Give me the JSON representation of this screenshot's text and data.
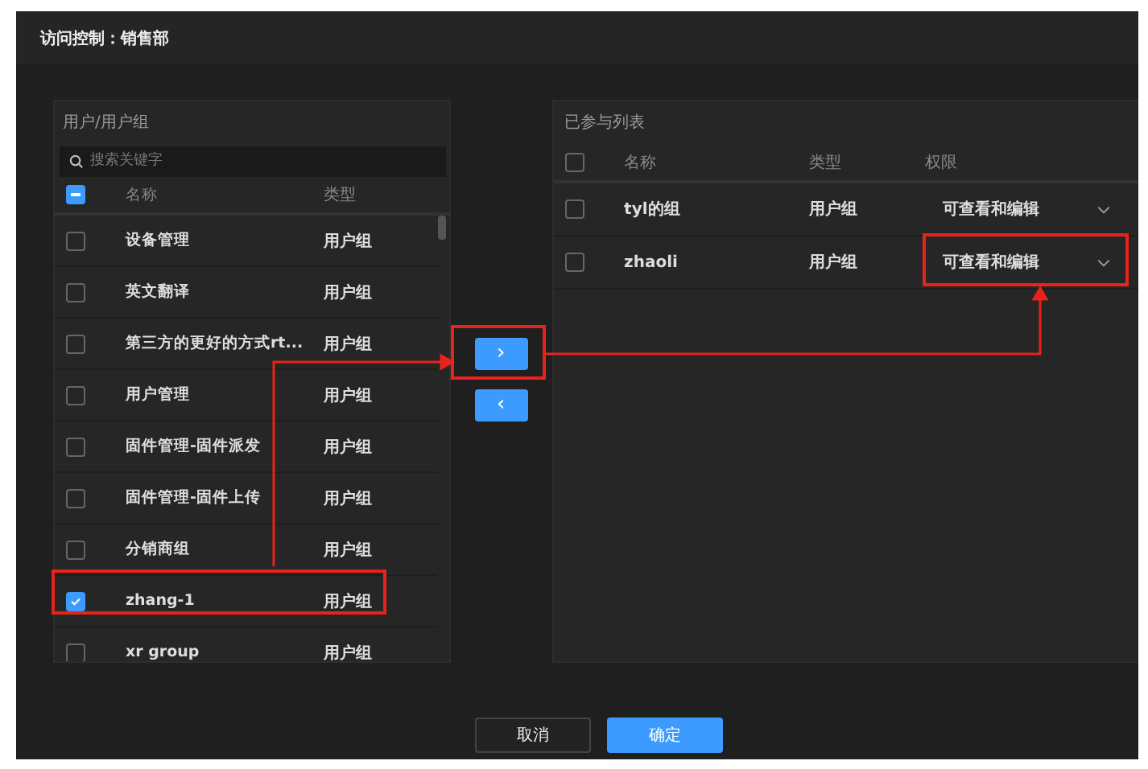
{
  "dialog": {
    "title": "访问控制：销售部"
  },
  "source": {
    "title": "用户/用户组",
    "search": {
      "placeholder": "搜索关键字"
    },
    "header": {
      "indeterminate": true,
      "columns": [
        "名称",
        "类型"
      ]
    },
    "rows": [
      {
        "name": "设备管理",
        "type": "用户组",
        "checked": false
      },
      {
        "name": "英文翻译",
        "type": "用户组",
        "checked": false
      },
      {
        "name": "第三方的更好的方式rt...",
        "type": "用户组",
        "checked": false
      },
      {
        "name": "用户管理",
        "type": "用户组",
        "checked": false
      },
      {
        "name": "固件管理-固件派发",
        "type": "用户组",
        "checked": false
      },
      {
        "name": "固件管理-固件上传",
        "type": "用户组",
        "checked": false
      },
      {
        "name": "分销商组",
        "type": "用户组",
        "checked": false
      },
      {
        "name": "zhang-1",
        "type": "用户组",
        "checked": true
      },
      {
        "name": "xr group",
        "type": "用户组",
        "checked": false
      }
    ]
  },
  "transfer_buttons": [
    {
      "label": "›"
    },
    {
      "label": "‹"
    }
  ],
  "target": {
    "title": "已参与列表",
    "header": {
      "checked": false,
      "columns": [
        "名称",
        "类型",
        "权限"
      ]
    },
    "rows": [
      {
        "name": "tyl的组",
        "type": "用户组",
        "permission": "可查看和编辑",
        "checked": false
      },
      {
        "name": "zhaoli",
        "type": "用户组",
        "permission": "可查看和编辑",
        "checked": false
      }
    ]
  },
  "buttons": [
    {
      "label": "取消",
      "kind": "secondary"
    },
    {
      "label": "确定",
      "kind": "primary"
    }
  ]
}
